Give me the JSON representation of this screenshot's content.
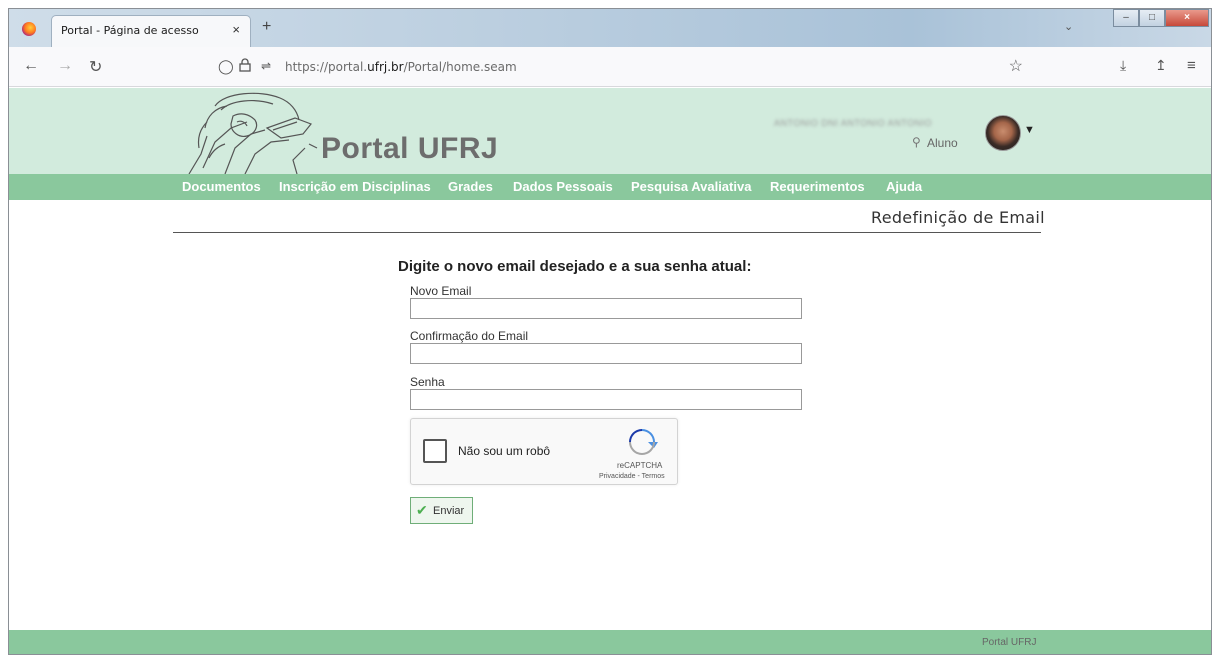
{
  "browser": {
    "tab_title": "Portal - Página de acesso",
    "tab_close": "×",
    "new_tab": "+",
    "url_prefix": "https://portal.",
    "url_domain": "ufrj.br",
    "url_path": "/Portal/home.seam",
    "icons": [
      "back-arrow-icon",
      "forward-arrow-icon",
      "reload-icon",
      "shield-icon",
      "lock-icon",
      "permissions-icon",
      "star-icon",
      "download-icon",
      "share-icon",
      "menu-icon"
    ]
  },
  "header": {
    "title": "Portal UFRJ",
    "user_name": "ANTONIO DNI ANTONIO ANTONIO",
    "user_role": "Aluno"
  },
  "menu": {
    "items": [
      "Documentos",
      "Inscrição em Disciplinas",
      "Grades",
      "Dados Pessoais",
      "Pesquisa Avaliativa",
      "Requerimentos",
      "Ajuda"
    ]
  },
  "page": {
    "section_title": "Redefinição de Email",
    "form_heading": "Digite o novo email desejado e a sua senha atual:",
    "fields": [
      {
        "label": "Novo Email",
        "value": ""
      },
      {
        "label": "Confirmação do Email",
        "value": ""
      },
      {
        "label": "Senha",
        "value": ""
      }
    ],
    "recaptcha": {
      "label": "Não sou um robô",
      "brand": "reCAPTCHA",
      "links": "Privacidade - Termos"
    },
    "submit_label": "Enviar"
  },
  "footer": {
    "text": "Portal UFRJ"
  },
  "colors": {
    "header_bg": "#d2ebdd",
    "menu_bg": "#8ac89d",
    "menu_text": "#ffffff",
    "title_color": "#6d6d6d"
  }
}
